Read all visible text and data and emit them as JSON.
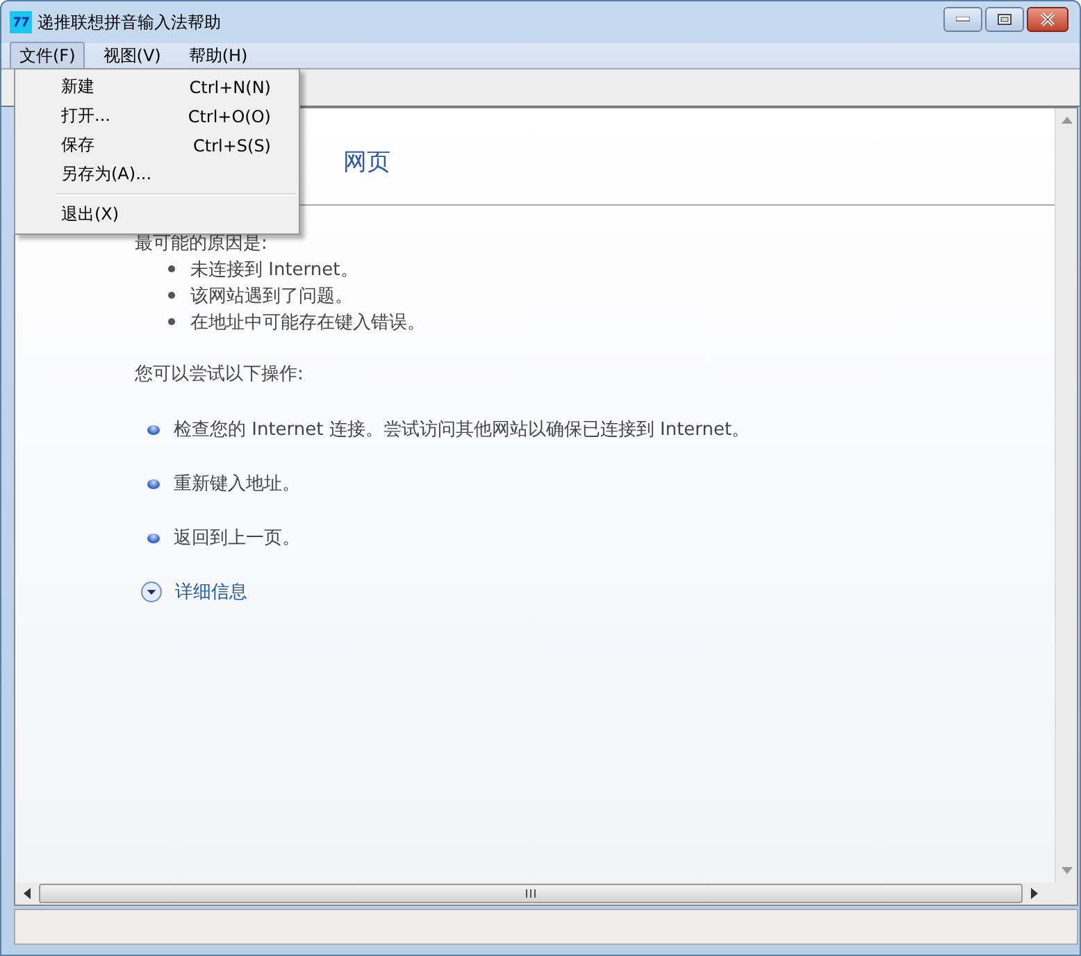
{
  "window": {
    "title": "递推联想拼音输入法帮助"
  },
  "menubar": [
    {
      "label": "文件(F)",
      "selected": true
    },
    {
      "label": "视图(V)",
      "selected": false
    },
    {
      "label": "帮助(H)",
      "selected": false
    }
  ],
  "file_menu": {
    "items": [
      {
        "kind": "item",
        "label": "新建",
        "shortcut": "Ctrl+N(N)"
      },
      {
        "kind": "item",
        "label": "打开...",
        "shortcut": "Ctrl+O(O)"
      },
      {
        "kind": "item",
        "label": "保存",
        "shortcut": "Ctrl+S(S)"
      },
      {
        "kind": "item",
        "label": "另存为(A)..."
      },
      {
        "kind": "separator"
      },
      {
        "kind": "item",
        "label": "退出(X)"
      }
    ]
  },
  "page": {
    "heading": "网页",
    "intro": "最可能的原因是:",
    "causes": [
      "未连接到 Internet。",
      "该网站遇到了问题。",
      "在地址中可能存在键入错误。"
    ],
    "try_label": "您可以尝试以下操作:",
    "actions": [
      "检查您的 Internet 连接。尝试访问其他网站以确保已连接到 Internet。",
      "重新键入地址。",
      "返回到上一页。"
    ],
    "details_link": "详细信息"
  }
}
